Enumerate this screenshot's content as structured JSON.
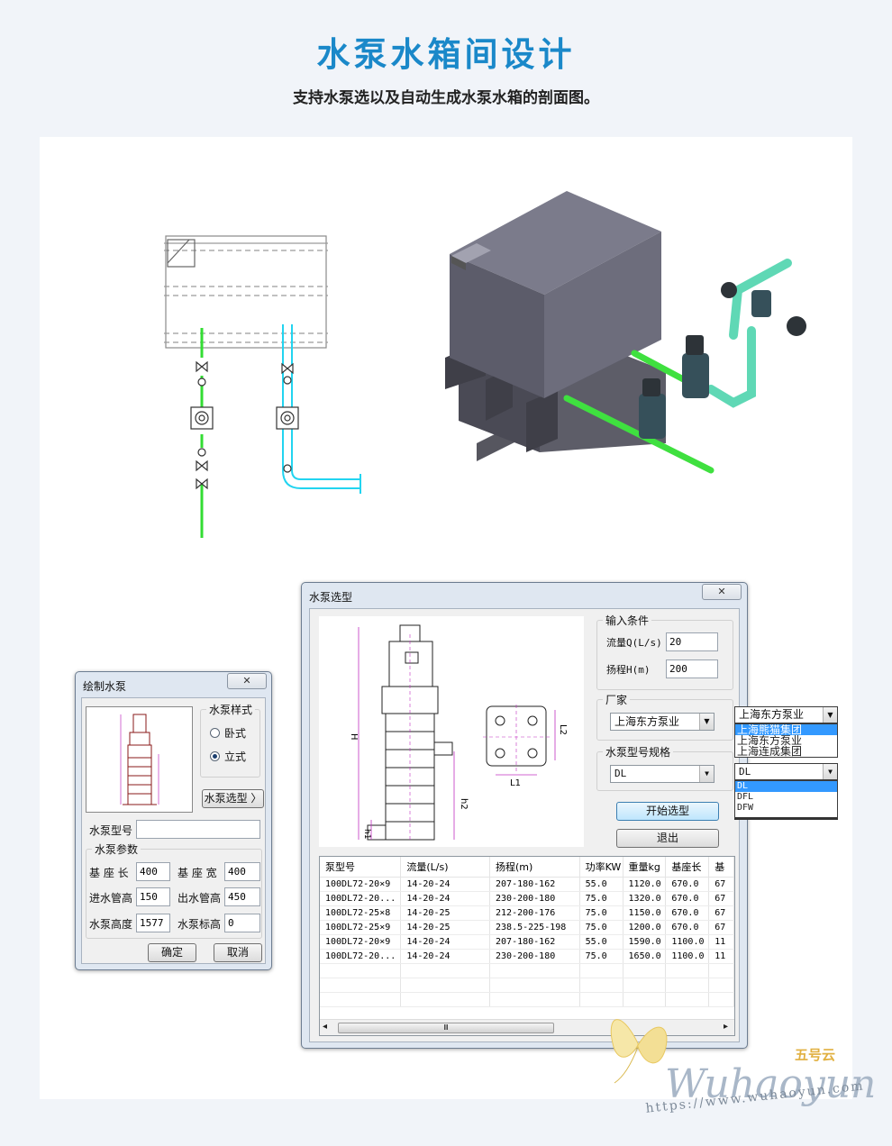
{
  "header": {
    "title": "水泵水箱间设计",
    "subtitle": "支持水泵选以及自动生成水泵水箱的剖面图。"
  },
  "draw_pump_dialog": {
    "title": "绘制水泵",
    "close_glyph": "✕",
    "style_group": "水泵样式",
    "radio_horizontal": "卧式",
    "radio_vertical": "立式",
    "radio_selected": "立式",
    "select_button": "水泵选型 〉",
    "model_label": "水泵型号",
    "model_value": "",
    "params_group": "水泵参数",
    "base_length_label": "基 座 长",
    "base_length_value": "400",
    "base_width_label": "基 座 宽",
    "base_width_value": "400",
    "inlet_height_label": "进水管高",
    "inlet_height_value": "150",
    "outlet_height_label": "出水管高",
    "outlet_height_value": "450",
    "pump_height_label": "水泵高度",
    "pump_height_value": "1577",
    "pump_elev_label": "水泵标高",
    "pump_elev_value": "0",
    "ok_button": "确定",
    "cancel_button": "取消"
  },
  "pump_select_dialog": {
    "title": "水泵选型",
    "close_glyph": "✕",
    "input_group": "输入条件",
    "flow_label": "流量Q(L/s)",
    "flow_value": "20",
    "head_label": "扬程H(m)",
    "head_value": "200",
    "vendor_group": "厂家",
    "vendor_value": "上海东方泵业",
    "model_group": "水泵型号规格",
    "model_value": "DL",
    "start_button": "开始选型",
    "exit_button": "退出",
    "vendor_dropdown": {
      "value": "上海东方泵业",
      "options": [
        "上海熊猫集团",
        "上海东方泵业",
        "上海连成集团"
      ],
      "highlighted": "上海熊猫集团"
    },
    "model_dropdown": {
      "value": "DL",
      "options": [
        "DL",
        "DFL",
        "DFW"
      ],
      "highlighted": "DL"
    },
    "drawing_labels": {
      "H": "H",
      "h2": "h2",
      "h1": "h1",
      "L1": "L1",
      "L2": "L2"
    },
    "table": {
      "columns": [
        "泵型号",
        "流量(L/s)",
        "扬程(m)",
        "功率KW",
        "重量kg",
        "基座长",
        "基"
      ],
      "rows": [
        [
          "100DL72-20×9",
          "14-20-24",
          "207-180-162",
          "55.0",
          "1120.0",
          "670.0",
          "67"
        ],
        [
          "100DL72-20...",
          "14-20-24",
          "230-200-180",
          "75.0",
          "1320.0",
          "670.0",
          "67"
        ],
        [
          "100DL72-25×8",
          "14-20-25",
          "212-200-176",
          "75.0",
          "1150.0",
          "670.0",
          "67"
        ],
        [
          "100DL72-25×9",
          "14-20-25",
          "238.5-225-198",
          "75.0",
          "1200.0",
          "670.0",
          "67"
        ],
        [
          "100DL72-20×9",
          "14-20-24",
          "207-180-162",
          "55.0",
          "1590.0",
          "1100.0",
          "11"
        ],
        [
          "100DL72-20...",
          "14-20-24",
          "230-200-180",
          "75.0",
          "1650.0",
          "1100.0",
          "11"
        ]
      ]
    },
    "scroll_left": "◂",
    "scroll_right": "▸",
    "scroll_grip": "Ⅲ"
  },
  "watermark": {
    "brand_cn": "五号云",
    "script": "Wuhaoyun",
    "url": "https://www.wuhaoyun.com"
  },
  "colors": {
    "title_blue": "#1a88c9",
    "pipe_green": "#33dd33",
    "pipe_cyan": "#22d4f0",
    "tank_gray": "#6e6e80",
    "dim_magenta": "#c030c0"
  }
}
